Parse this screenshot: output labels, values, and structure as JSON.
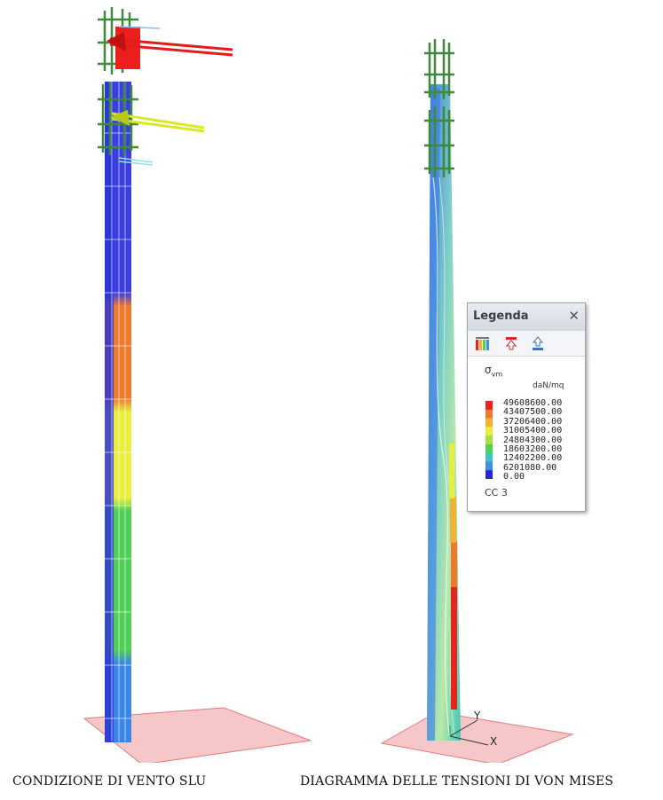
{
  "captions": {
    "left": "CONDIZIONE DI VENTO SLU",
    "right": "DIAGRAMMA DELLE TENSIONI DI VON MISES"
  },
  "legend": {
    "title": "Legenda",
    "symbol": "σ",
    "symbol_sub": "vm",
    "unit": "daN/mq",
    "values": [
      "49608600.00",
      "43407500.00",
      "37206400.00",
      "31005400.00",
      "24804300.00",
      "18603200.00",
      "12402200.00",
      "6201080.00",
      "0.00"
    ],
    "colors": [
      "#e8231e",
      "#f0782a",
      "#f3b233",
      "#e9ee3a",
      "#a9e03e",
      "#4fd24f",
      "#3ec7b8",
      "#3f8ee8",
      "#2626e0"
    ],
    "combo_label": "CC 3",
    "tools": [
      "palette-icon",
      "upload-red-icon",
      "download-blue-icon"
    ]
  },
  "axes": {
    "y_label": "Y",
    "x_label": "X"
  }
}
